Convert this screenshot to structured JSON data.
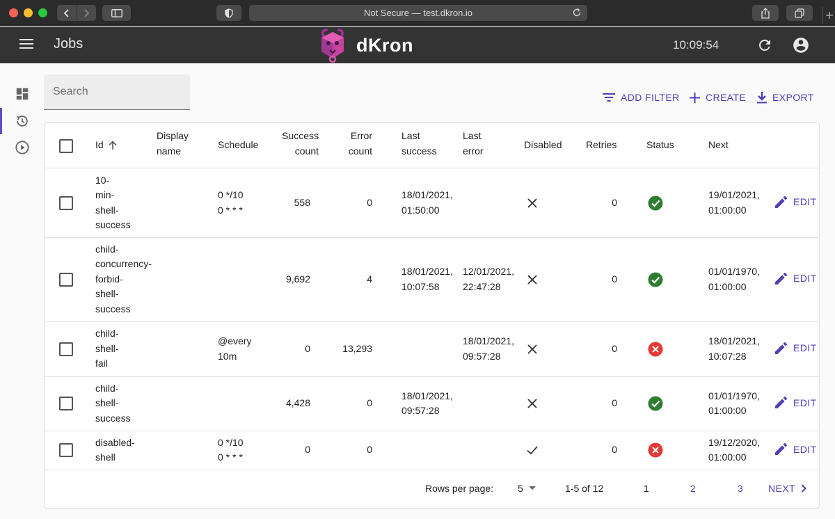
{
  "browser": {
    "address": "Not Secure — test.dkron.io"
  },
  "appbar": {
    "title": "Jobs",
    "logo_text": "dKron",
    "clock": "10:09:54"
  },
  "search": {
    "placeholder": "Search"
  },
  "toolbar": {
    "add_filter": "ADD FILTER",
    "create": "CREATE",
    "export": "EXPORT"
  },
  "table": {
    "headers": {
      "id": "Id",
      "display_name": [
        "Display",
        "name"
      ],
      "schedule": "Schedule",
      "success_count": [
        "Success",
        "count"
      ],
      "error_count": [
        "Error",
        "count"
      ],
      "last_success": [
        "Last",
        "success"
      ],
      "last_error": [
        "Last",
        "error"
      ],
      "disabled": "Disabled",
      "retries": "Retries",
      "status": "Status",
      "next": "Next"
    },
    "edit_label": "EDIT",
    "rows": [
      {
        "id": [
          "10-",
          "min-",
          "shell-",
          "success"
        ],
        "schedule": [
          "0 */10",
          "0 * * *"
        ],
        "success_count": "558",
        "error_count": "0",
        "last_success": [
          "18/01/2021,",
          "01:50:00"
        ],
        "last_error": [],
        "disabled": false,
        "retries": "0",
        "status": "success",
        "next": [
          "19/01/2021,",
          "01:00:00"
        ]
      },
      {
        "id": [
          "child-",
          "concurrency-",
          "forbid-",
          "shell-",
          "success"
        ],
        "schedule": [],
        "success_count": "9,692",
        "error_count": "4",
        "last_success": [
          "18/01/2021,",
          "10:07:58"
        ],
        "last_error": [
          "12/01/2021,",
          "22:47:28"
        ],
        "disabled": false,
        "retries": "0",
        "status": "success",
        "next": [
          "01/01/1970,",
          "01:00:00"
        ]
      },
      {
        "id": [
          "child-",
          "shell-",
          "fail"
        ],
        "schedule": [
          "@every",
          "10m"
        ],
        "success_count": "0",
        "error_count": "13,293",
        "last_success": [],
        "last_error": [
          "18/01/2021,",
          "09:57:28"
        ],
        "disabled": false,
        "retries": "0",
        "status": "failed",
        "next": [
          "18/01/2021,",
          "10:07:28"
        ]
      },
      {
        "id": [
          "child-",
          "shell-",
          "success"
        ],
        "schedule": [],
        "success_count": "4,428",
        "error_count": "0",
        "last_success": [
          "18/01/2021,",
          "09:57:28"
        ],
        "last_error": [],
        "disabled": false,
        "retries": "0",
        "status": "success",
        "next": [
          "01/01/1970,",
          "01:00:00"
        ]
      },
      {
        "id": [
          "disabled-",
          "shell"
        ],
        "schedule": [
          "0 */10",
          "0 * * *"
        ],
        "success_count": "0",
        "error_count": "0",
        "last_success": [],
        "last_error": [],
        "disabled": true,
        "retries": "0",
        "status": "failed",
        "next": [
          "19/12/2020,",
          "01:00:00"
        ]
      }
    ]
  },
  "pagination": {
    "rows_per_page_label": "Rows per page:",
    "rows_per_page": "5",
    "range": "1-5 of 12",
    "pages": [
      "1",
      "2",
      "3"
    ],
    "next": "NEXT"
  },
  "colors": {
    "accent": "#4e3fb8",
    "success": "#2e7d32",
    "error": "#e53935",
    "appbar": "#333333"
  },
  "icons": {
    "sidebar": [
      "dashboard-icon",
      "history-icon",
      "play-circle-icon"
    ],
    "appbar": [
      "menu-icon",
      "refresh-icon",
      "account-circle-icon"
    ],
    "toolbar": [
      "filter-list-icon",
      "add-icon",
      "download-icon"
    ]
  }
}
